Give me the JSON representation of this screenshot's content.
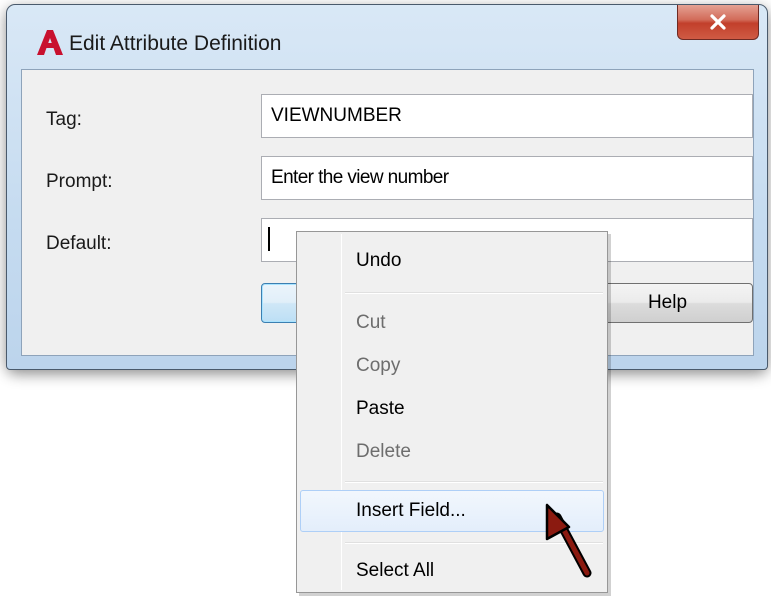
{
  "window": {
    "title": "Edit Attribute Definition",
    "app_icon": "autocad-logo-icon",
    "close_icon": "close-x-icon"
  },
  "form": {
    "tag_label": "Tag:",
    "tag_value": "VIEWNUMBER",
    "prompt_label": "Prompt:",
    "prompt_value": "Enter the view number",
    "default_label": "Default:",
    "default_value": ""
  },
  "buttons": {
    "help_label": "Help"
  },
  "context_menu": {
    "items": [
      {
        "label": "Undo",
        "enabled": true
      },
      {
        "label": "Cut",
        "enabled": false
      },
      {
        "label": "Copy",
        "enabled": false
      },
      {
        "label": "Paste",
        "enabled": true
      },
      {
        "label": "Delete",
        "enabled": false
      },
      {
        "label": "Insert Field...",
        "enabled": true,
        "highlighted": true
      },
      {
        "label": "Select All",
        "enabled": true
      }
    ]
  },
  "colors": {
    "accent_red": "#c8102e",
    "close_button": "#c94a36",
    "cursor_arrow": "#8b1a10"
  }
}
